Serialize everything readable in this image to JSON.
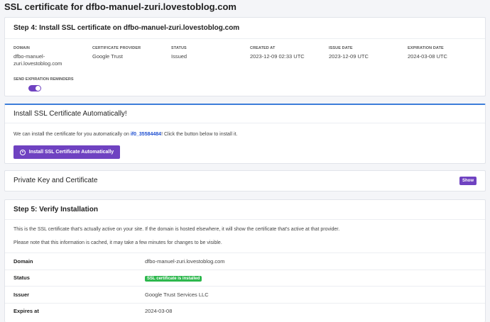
{
  "page": {
    "title": "SSL certificate for dfbo-manuel-zuri.lovestoblog.com"
  },
  "step4": {
    "title": "Step 4: Install SSL certificate on dfbo-manuel-zuri.lovestoblog.com",
    "fields": [
      {
        "label": "DOMAIN",
        "value": "dfbo-manuel-\nzuri.lovestoblog.com"
      },
      {
        "label": "CERTIFICATE PROVIDER",
        "value": "Google Trust"
      },
      {
        "label": "STATUS",
        "value": "Issued"
      },
      {
        "label": "CREATED AT",
        "value": "2023-12-09 02:33 UTC"
      },
      {
        "label": "ISSUE DATE",
        "value": "2023-12-09 UTC"
      },
      {
        "label": "EXPIRATION DATE",
        "value": "2024-03-08 UTC"
      }
    ],
    "reminders_label": "SEND EXPIRATION REMINDERS",
    "reminders_enabled": true
  },
  "auto_install": {
    "title": "Install SSL Certificate Automatically!",
    "text_before": "We can install the certificate for you automatically on ",
    "server": "if0_35584484",
    "text_after": "! Click the button below to install it.",
    "button_label": "Install SSL Certificate Automatically"
  },
  "private_key": {
    "title": "Private Key and Certificate",
    "show_label": "Show"
  },
  "step5": {
    "title": "Step 5: Verify Installation",
    "text1": "This is the SSL certificate that's actually active on your site. If the domain is hosted elsewhere, it will show the certificate that's active at that provider.",
    "text2": "Please note that this information is cached, it may take a few minutes for changes to be visible.",
    "rows": [
      {
        "key": "Domain",
        "value": "dfbo-manuel-zuri.lovestoblog.com"
      },
      {
        "key": "Status",
        "value": "SSL certificate is installed"
      },
      {
        "key": "Issuer",
        "value": "Google Trust Services LLC"
      },
      {
        "key": "Expires at",
        "value": "2024-03-08"
      }
    ]
  },
  "colors": {
    "accent": "#6f42c1",
    "success": "#2db84d",
    "link": "#1e4fd1"
  }
}
